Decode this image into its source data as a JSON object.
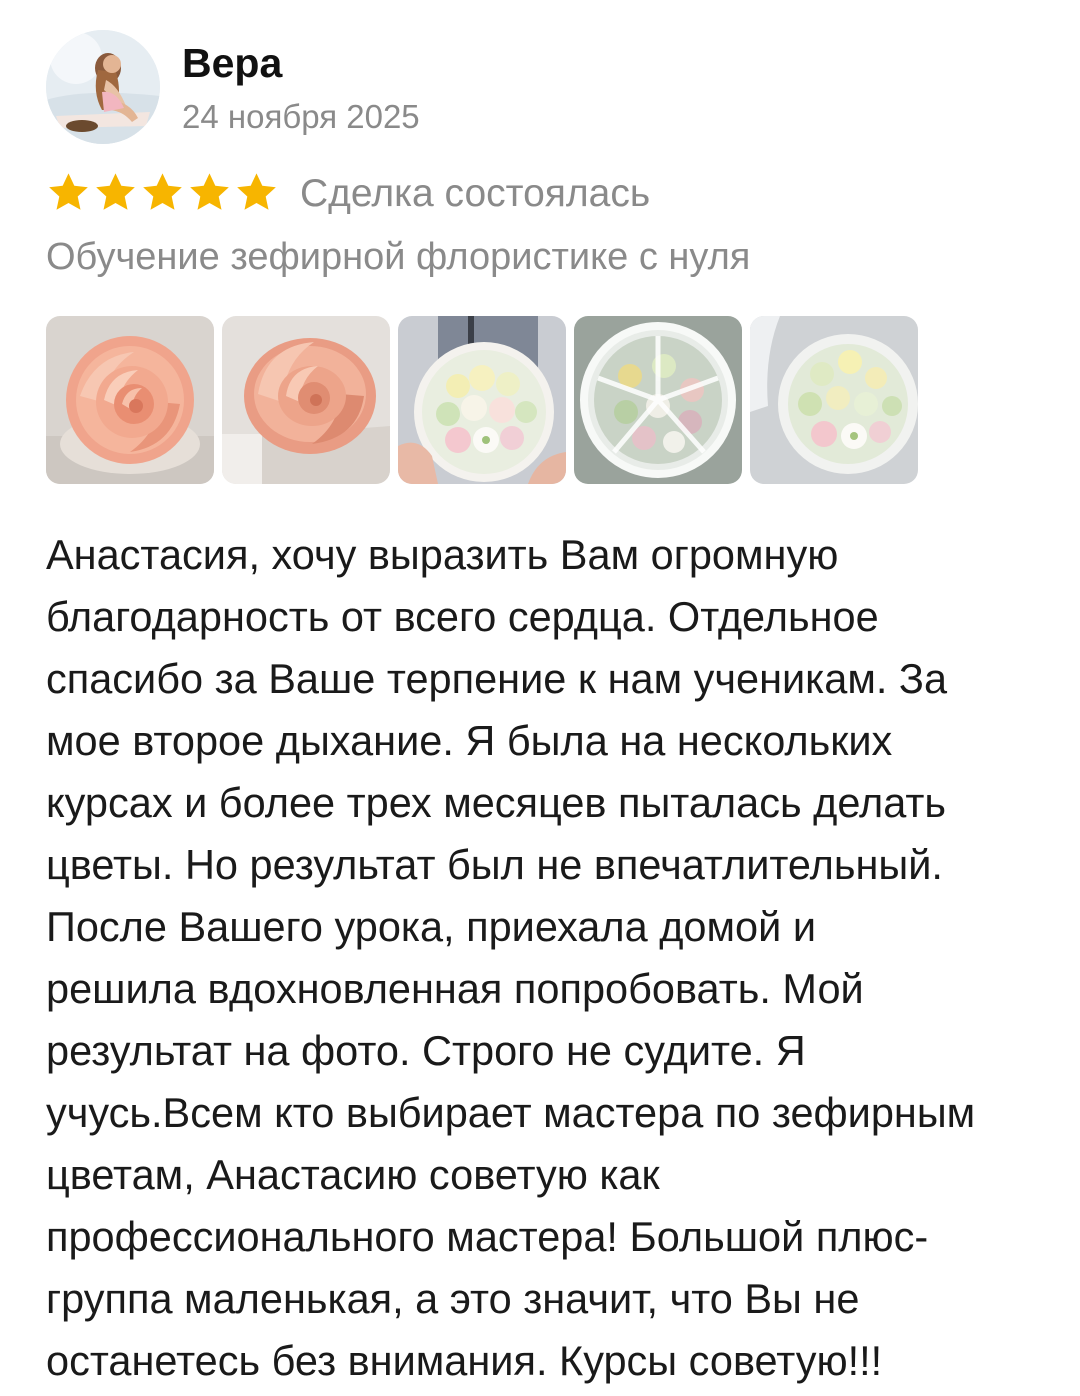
{
  "review": {
    "author": "Вера",
    "date": "24 ноября 2025",
    "rating": 5,
    "rating_max": 5,
    "deal_status": "Сделка состоялась",
    "course": "Обучение зефирной флористике с нуля",
    "photos": [
      "rose-photo",
      "rose-photo",
      "flower-box-photo",
      "flower-box-lid-photo",
      "flower-box-photo"
    ],
    "text": "Анастасия, хочу выразить Вам огромную\nблагодарность от всего сердца. Отдельное\nспасибо за Ваше терпение к нам ученикам. За\nмое второе дыхание. Я была на нескольких\nкурсах и более трех месяцев пыталась  делать\nцветы. Но результат был не впечатлительный.\nПосле Вашего урока,  приехала домой и\nрешила вдохновленная  попробовать. Мой\nрезультат на фото. Строго не судите. Я\nучусь.Всем кто выбирает мастера по зефирным\nцветам, Анастасию советую как\nпрофессионального мастера! Большой плюс-\nгруппа маленькая, а это значит, что Вы не\nостанетесь без внимания. Курсы советую!!!"
  },
  "colors": {
    "star": "#f7b500",
    "muted_text": "#8a8a8a",
    "main_text": "#1a1a1a"
  },
  "icons": {
    "star": "star-icon",
    "avatar": "avatar-image"
  }
}
